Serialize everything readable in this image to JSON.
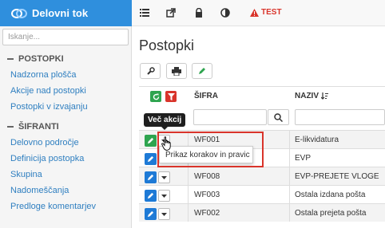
{
  "sidebar": {
    "brand": "Delovni tok",
    "search_placeholder": "Iskanje...",
    "sections": [
      {
        "title": "POSTOPKI",
        "items": [
          "Nadzorna plošča",
          "Akcije nad postopki",
          "Postopki v izvajanju"
        ]
      },
      {
        "title": "ŠIFRANTI",
        "items": [
          "Delovno področje",
          "Definicija postopka",
          "Skupina",
          "Nadomeščanja",
          "Predloge komentarjev"
        ]
      }
    ]
  },
  "topbar": {
    "icons": [
      "list-icon",
      "external-link-icon",
      "lock-icon",
      "contrast-icon"
    ],
    "test_label": "TEST"
  },
  "main": {
    "title": "Postopki",
    "toolbar_icons": [
      "wrench-icon",
      "print-icon",
      "pencil-icon"
    ],
    "columns": {
      "sifra": "ŠIFRA",
      "naziv": "NAZIV"
    },
    "rows": [
      {
        "sifra": "WF001",
        "naziv": "E-likvidatura"
      },
      {
        "sifra": "",
        "naziv": "EVP"
      },
      {
        "sifra": "WF008",
        "naziv": "EVP-PREJETE VLOGE"
      },
      {
        "sifra": "WF003",
        "naziv": "Ostala izdana pošta"
      },
      {
        "sifra": "WF002",
        "naziv": "Ostala prejeta pošta"
      }
    ],
    "tooltip": "Več akcij",
    "dropdown_item": "Prikaz korakov in pravic"
  },
  "colors": {
    "brand": "#2f8fdd",
    "green": "#2ea44f",
    "blue": "#1e7ad6",
    "red": "#d9342b"
  }
}
